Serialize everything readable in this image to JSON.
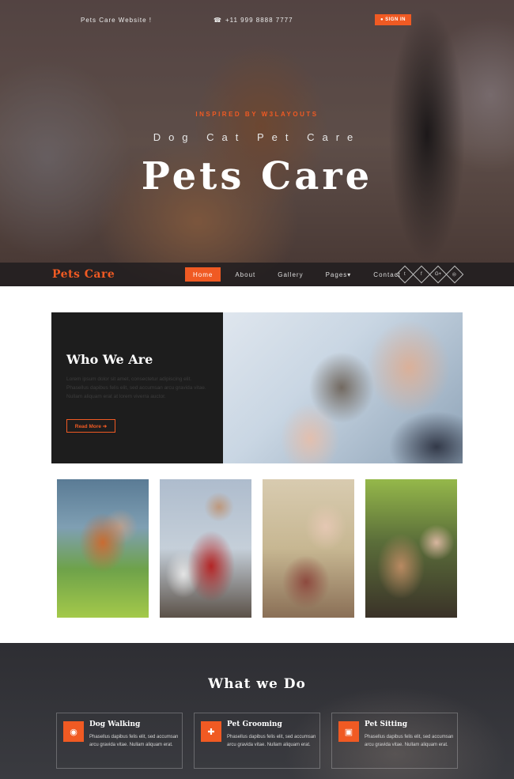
{
  "topbar": {
    "site_link": "Pets Care Website !",
    "phone": "+11 999 8888 7777",
    "signin_label": "SIGN IN"
  },
  "hero": {
    "inspired": "INSPIRED BY W3LAYOUTS",
    "subtitle": "Dog Cat Pet Care",
    "title": "Pets Care"
  },
  "nav": {
    "logo": "Pets Care",
    "items": [
      {
        "label": "Home",
        "active": true
      },
      {
        "label": "About"
      },
      {
        "label": "Gallery"
      },
      {
        "label": "Pages▾"
      },
      {
        "label": "Contact"
      }
    ],
    "socials": [
      {
        "icon": "twitter-icon",
        "glyph": "t"
      },
      {
        "icon": "facebook-icon",
        "glyph": "f"
      },
      {
        "icon": "google-plus-icon",
        "glyph": "G+"
      },
      {
        "icon": "dribbble-icon",
        "glyph": "◎"
      }
    ]
  },
  "who": {
    "title": "Who We Are",
    "text": "Lorem ipsum dolor sit amet, consectetur adipiscing elit. Phasellus dapibus felis elit, sed accumsan arcu gravida vitae. Nullam aliquam erat at lorem viverra auctor.",
    "read_more": "Read More ➜"
  },
  "services": {
    "title": "What we Do",
    "items": [
      {
        "title": "Dog Walking",
        "icon": "eye-icon",
        "glyph": "◉",
        "text": "Phasellus dapibus felis elit, sed accumsan arcu gravida vitae. Nullam aliquam erat."
      },
      {
        "title": "Pet Grooming",
        "icon": "ambulance-icon",
        "glyph": "✚",
        "text": "Phasellus dapibus felis elit, sed accumsan arcu gravida vitae. Nullam aliquam erat."
      },
      {
        "title": "Pet Sitting",
        "icon": "medkit-icon",
        "glyph": "▣",
        "text": "Phasellus dapibus felis elit, sed accumsan arcu gravida vitae. Nullam aliquam erat."
      }
    ]
  },
  "colors": {
    "accent": "#f05a23",
    "dark": "#1d1d1d"
  }
}
